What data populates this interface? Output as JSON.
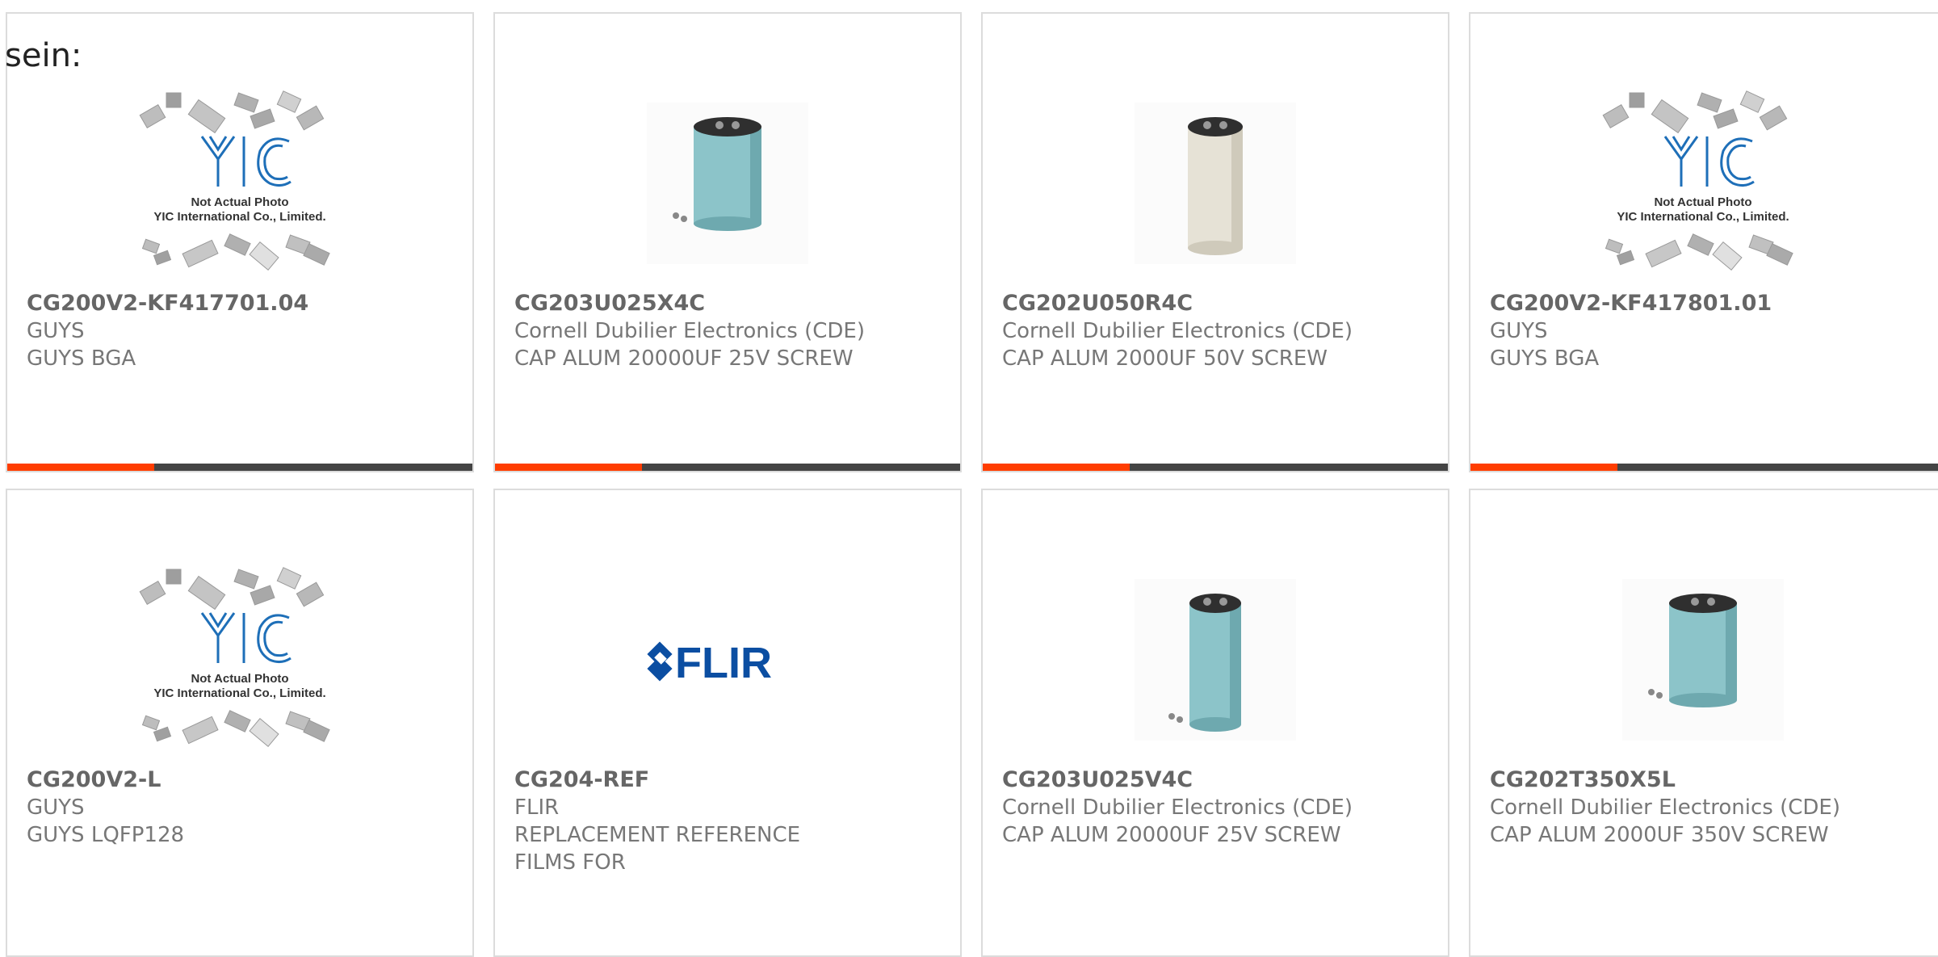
{
  "lead_text": "sein:",
  "accent_color": "#ff3d00",
  "bar_color": "#444444",
  "yic_photo": {
    "caption_line1": "Not Actual Photo",
    "caption_line2": "YIC International Co., Limited.",
    "logo_text": "YIC"
  },
  "flir_logo_text": "FLIR",
  "cards": [
    {
      "part_number": "CG200V2-KF417701.04",
      "manufacturer": "GUYS",
      "description_lines": [
        "GUYS BGA"
      ],
      "image": "yic-placeholder"
    },
    {
      "part_number": "CG203U025X4C",
      "manufacturer": "Cornell Dubilier Electronics (CDE)",
      "description_lines": [
        "CAP ALUM 20000UF 25V SCREW"
      ],
      "image": "capacitor-wide"
    },
    {
      "part_number": "CG202U050R4C",
      "manufacturer": "Cornell Dubilier Electronics (CDE)",
      "description_lines": [
        "CAP ALUM 2000UF 50V SCREW"
      ],
      "image": "capacitor-beige"
    },
    {
      "part_number": "CG200V2-KF417801.01",
      "manufacturer": "GUYS",
      "description_lines": [
        "GUYS BGA"
      ],
      "image": "yic-placeholder"
    },
    {
      "part_number": "CG200V2-L",
      "manufacturer": "GUYS",
      "description_lines": [
        "GUYS LQFP128"
      ],
      "image": "yic-placeholder"
    },
    {
      "part_number": "CG204-REF",
      "manufacturer": "FLIR",
      "description_lines": [
        "REPLACEMENT REFERENCE",
        "FILMS FOR"
      ],
      "image": "flir-logo"
    },
    {
      "part_number": "CG203U025V4C",
      "manufacturer": "Cornell Dubilier Electronics (CDE)",
      "description_lines": [
        "CAP ALUM 20000UF 25V SCREW"
      ],
      "image": "capacitor-tall"
    },
    {
      "part_number": "CG202T350X5L",
      "manufacturer": "Cornell Dubilier Electronics (CDE)",
      "description_lines": [
        "CAP ALUM 2000UF 350V SCREW"
      ],
      "image": "capacitor-wide"
    }
  ]
}
